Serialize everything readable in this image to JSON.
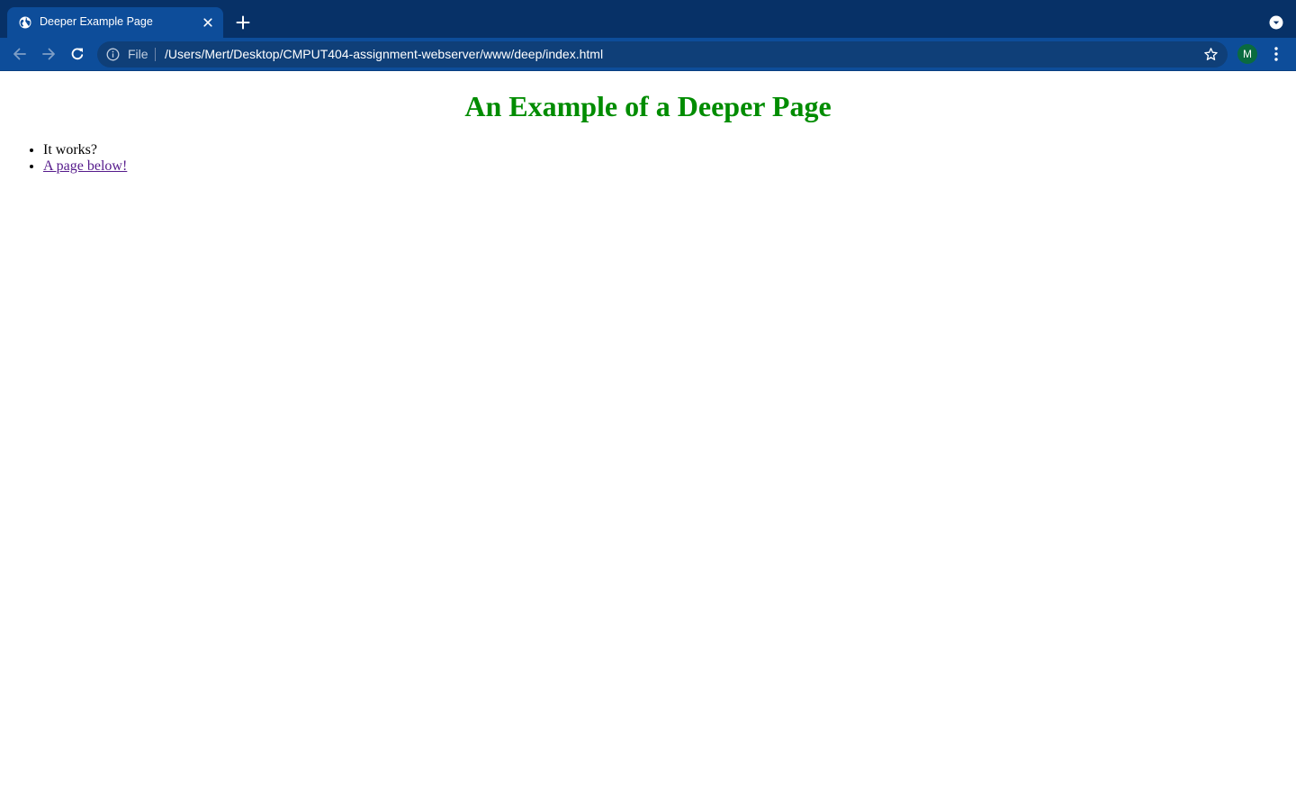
{
  "browser": {
    "tab": {
      "title": "Deeper Example Page"
    },
    "omnibox": {
      "scheme_label": "File",
      "url": "/Users/Mert/Desktop/CMPUT404-assignment-webserver/www/deep/index.html"
    },
    "profile": {
      "initial": "M"
    },
    "colors": {
      "frame": "#073167",
      "toolbar": "#0d4d9a",
      "omnibox": "#0f3f78",
      "avatar": "#0a6b3f"
    },
    "icons": [
      "globe-icon",
      "close-icon",
      "plus-icon",
      "chevron-down-icon",
      "back-arrow-icon",
      "forward-arrow-icon",
      "reload-icon",
      "info-icon",
      "star-icon",
      "kebab-menu-icon"
    ]
  },
  "page": {
    "heading": "An Example of a Deeper Page",
    "heading_color": "#008c00",
    "list": {
      "item_1": "It works?",
      "item_2_link": "A page below!"
    },
    "link_color": "#551a8b"
  }
}
